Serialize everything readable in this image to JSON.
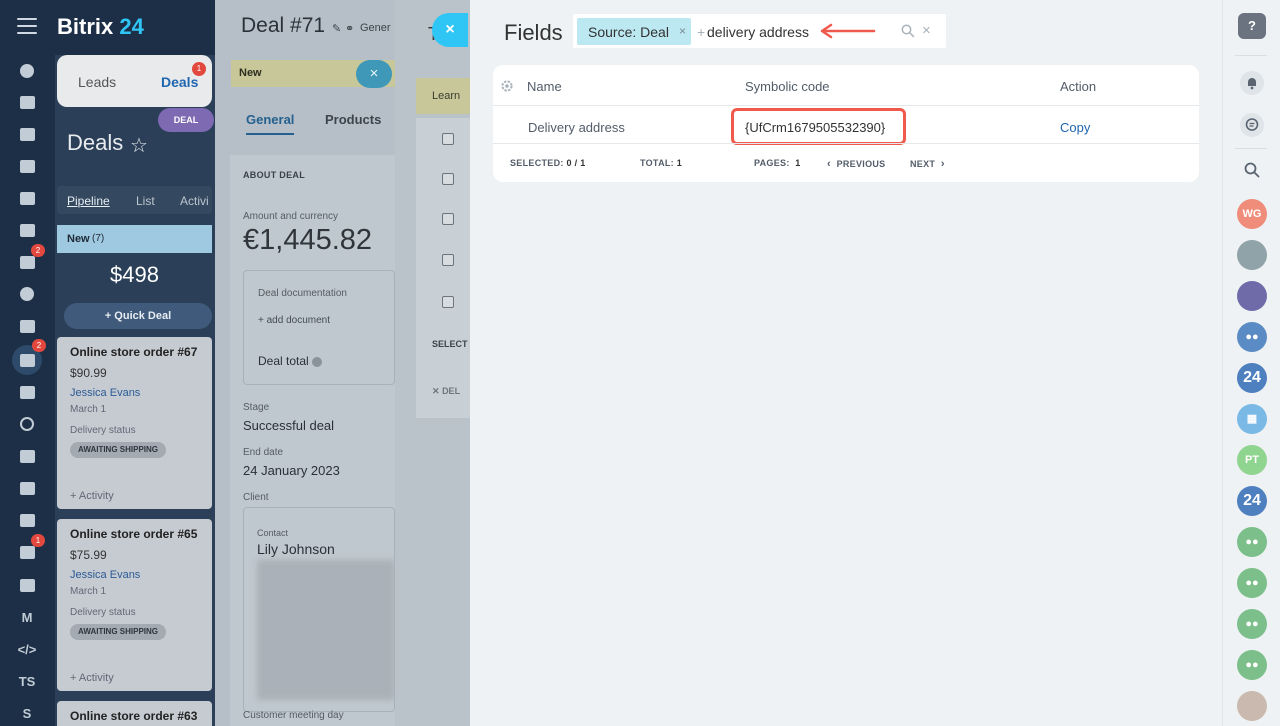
{
  "left_nav": {
    "badges": {
      "mail": "2",
      "crm": "2",
      "robot": "1"
    },
    "ts_label": "TS",
    "s_label": "S"
  },
  "app": {
    "logo_text": "Bitrix",
    "logo_num": "24"
  },
  "deals_panel": {
    "tab_leads": "Leads",
    "tab_deals": "Deals",
    "tab_deals_badge": "1",
    "title": "Deals",
    "deal_pill": "DEAL",
    "views": [
      "Pipeline",
      "List",
      "Activi"
    ],
    "stage": {
      "name": "New",
      "count": "(7)",
      "sum": "$498"
    },
    "quick_deal": "+ Quick Deal",
    "cards": [
      {
        "title": "Online store order #67",
        "price": "$90.99",
        "user": "Jessica Evans",
        "date": "March 1",
        "status_label": "Delivery status",
        "status": "AWAITING SHIPPING",
        "activity": "+ Activity"
      },
      {
        "title": "Online store order #65",
        "price": "$75.99",
        "user": "Jessica Evans",
        "date": "March 1",
        "status_label": "Delivery status",
        "status": "AWAITING SHIPPING",
        "activity": "+ Activity"
      },
      {
        "title": "Online store order #63"
      }
    ]
  },
  "deal71": {
    "title": "Deal #71",
    "subtitle": "Gener",
    "stage_new": "New",
    "close": "×",
    "tab_general": "General",
    "tab_products": "Products",
    "about": "ABOUT DEAL",
    "amount_label": "Amount and currency",
    "amount_value": "€1,445.82",
    "doc_label": "Deal documentation",
    "doc_add": "+ add document",
    "deal_total": "Deal total",
    "stage_label": "Stage",
    "stage_value": "Successful deal",
    "end_label": "End date",
    "end_value": "24 January 2023",
    "client_label": "Client",
    "contact_label": "Contact",
    "contact_name": "Lily Johnson",
    "meeting_label": "Customer meeting day"
  },
  "mid_panel": {
    "t_letter": "T",
    "learn": "Learn",
    "select": "SELECT",
    "delete": "DEL"
  },
  "fields": {
    "close": "×",
    "title": "Fields",
    "search": {
      "chip_label": "Source: Deal",
      "chip_remove": "×",
      "plus": "+",
      "query": "delivery address",
      "clear": "×"
    },
    "table": {
      "headers": {
        "name": "Name",
        "code": "Symbolic code",
        "action": "Action"
      },
      "rows": [
        {
          "name": "Delivery address",
          "code": "{UfCrm1679505532390}",
          "action": "Copy"
        }
      ],
      "footer": {
        "selected_label": "SELECTED:",
        "selected_value": "0 / 1",
        "total_label": "TOTAL:",
        "total_value": "1",
        "pages_label": "PAGES:",
        "pages_value": "1",
        "prev": "PREVIOUS",
        "next": "NEXT"
      }
    }
  },
  "right_bar": {
    "help": "?",
    "avatars": [
      "WG",
      "PT"
    ],
    "app_24": "24"
  },
  "colors": {
    "accent": "#2fc6f6",
    "link": "#2066b0",
    "highlight": "#ef5a4c",
    "nav_bg": "#1c2f46"
  }
}
